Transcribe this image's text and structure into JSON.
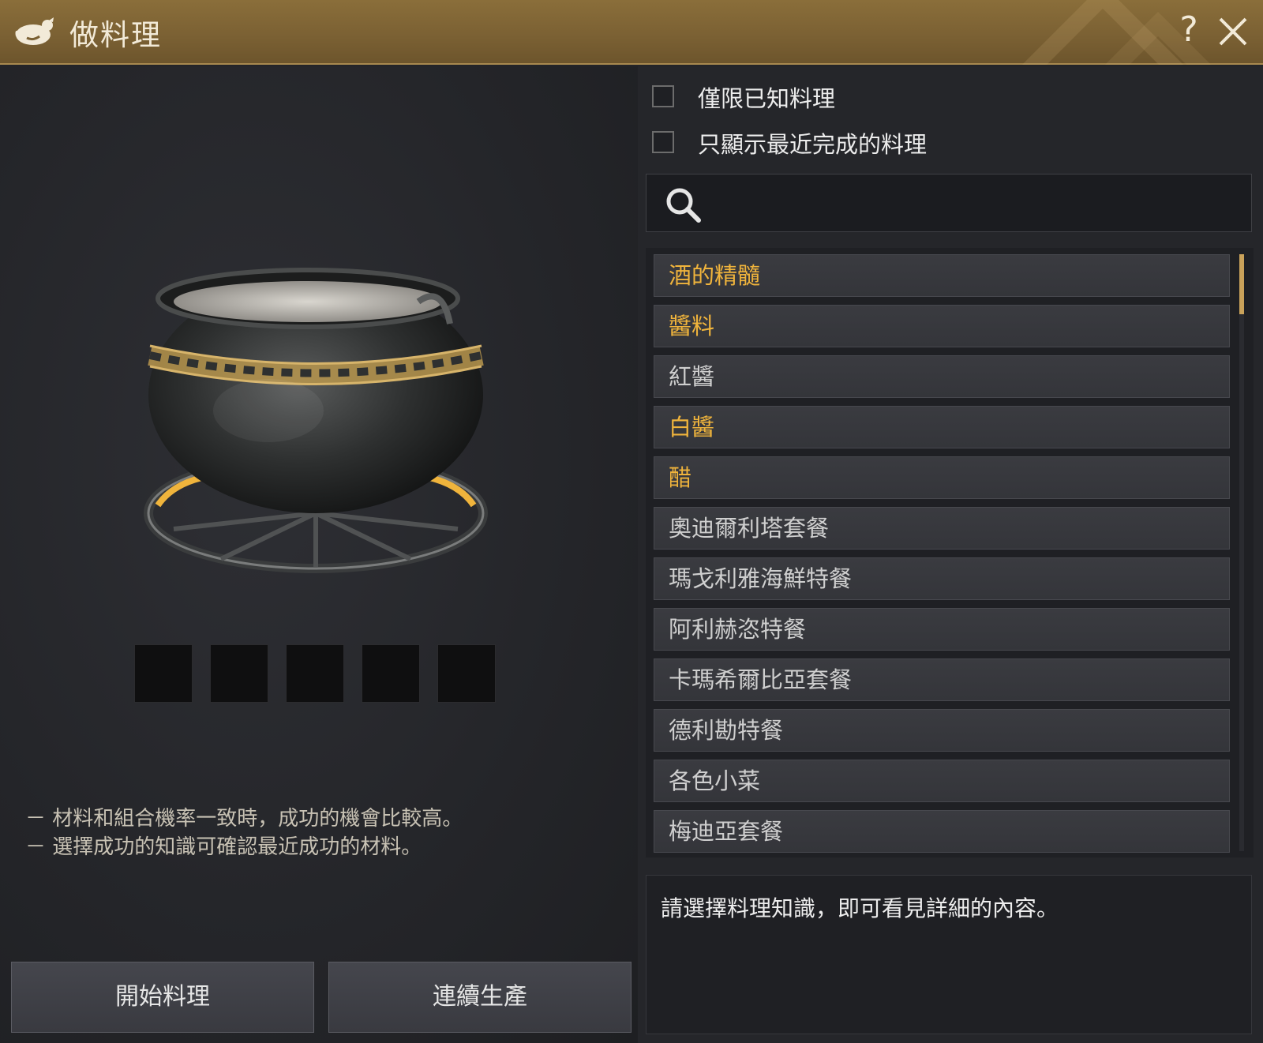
{
  "window": {
    "title": "做料理",
    "icon": "chicken-icon",
    "help_label": "?",
    "close_icon": "close-icon"
  },
  "filters": [
    {
      "label": "僅限已知料理",
      "checked": false
    },
    {
      "label": "只顯示最近完成的料理",
      "checked": false
    }
  ],
  "search": {
    "placeholder": "",
    "icon": "search-icon"
  },
  "recipes": [
    {
      "label": "酒的精髓",
      "style": "gold"
    },
    {
      "label": "醬料",
      "style": "gold"
    },
    {
      "label": "紅醬",
      "style": "grey"
    },
    {
      "label": "白醬",
      "style": "gold"
    },
    {
      "label": "醋",
      "style": "gold"
    },
    {
      "label": "奧迪爾利塔套餐",
      "style": "grey"
    },
    {
      "label": "瑪戈利雅海鮮特餐",
      "style": "grey"
    },
    {
      "label": "阿利赫恣特餐",
      "style": "grey"
    },
    {
      "label": "卡瑪希爾比亞套餐",
      "style": "grey"
    },
    {
      "label": "德利勘特餐",
      "style": "grey"
    },
    {
      "label": "各色小菜",
      "style": "grey"
    },
    {
      "label": "梅迪亞套餐",
      "style": "grey"
    }
  ],
  "ingredient_slots": 5,
  "hints": [
    "－ 材料和組合機率一致時，成功的機會比較高。",
    "－ 選擇成功的知識可確認最近成功的材料。"
  ],
  "detail_text": "請選擇料理知識，即可看見詳細的內容。",
  "buttons": {
    "start": "開始料理",
    "continuous": "連續生產"
  },
  "colors": {
    "accent_gold": "#f0b43c",
    "title_bar": "#7a6033",
    "panel": "#25262a"
  }
}
